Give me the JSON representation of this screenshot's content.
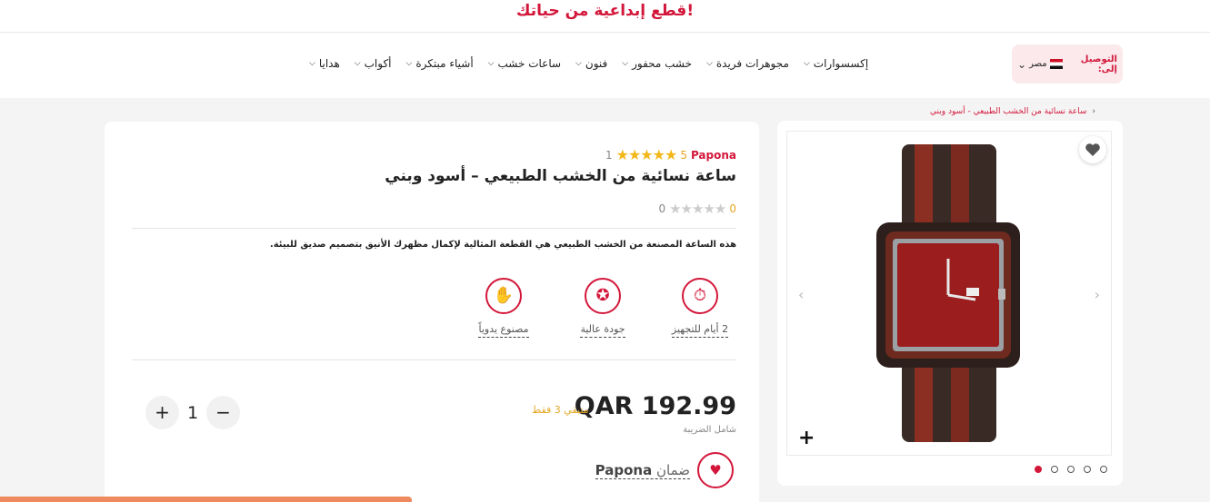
{
  "promo": {
    "text": "قطع إبداعية من حياتك!"
  },
  "shipping": {
    "label": "التوصيل إلى:",
    "country": "مصر"
  },
  "menu": [
    {
      "label": "إكسسوارات"
    },
    {
      "label": "مجوهرات فريدة"
    },
    {
      "label": "خشب محفور"
    },
    {
      "label": "فنون"
    },
    {
      "label": "ساعات خشب"
    },
    {
      "label": "أشياء مبتكرة"
    },
    {
      "label": "أكواب"
    },
    {
      "label": "هدايا"
    }
  ],
  "breadcrumb": "ساعة نسائية من الخشب الطبيعي - أسود وبني",
  "product": {
    "brand": "Papona",
    "rating_value": "5",
    "stars": "★★★★★",
    "rating_count": "1",
    "title": "ساعة نسائية من الخشب الطبيعي – أسود وبني",
    "reviews_rating": "0",
    "reviews_stars": "★★★★★",
    "reviews_count": "0",
    "description": "هذه الساعة المصنعة من الخشب الطبيعي هي القطعة المثالية لإكمال مظهرك الأنيق بتصميم صديق للبيئة.",
    "features": [
      {
        "label": "2 أيام للتجهيز",
        "icon": "timer-icon"
      },
      {
        "label": "جودة عالية",
        "icon": "quality-badge-icon"
      },
      {
        "label": "مصنوع يدوياً",
        "icon": "hand-icon"
      }
    ],
    "price": "QAR 192.99",
    "stock": "متبقي 3 فقط",
    "tax": "شامل الضريبة",
    "quantity": "1",
    "guarantee_label": "ضمان",
    "guarantee_brand": "Papona"
  },
  "gallery": {
    "dots": 5,
    "active_dot": 0,
    "prev": "‹",
    "next": "›",
    "zoom": "+"
  },
  "colors": {
    "accent": "#d3173a",
    "star": "#f2b71a",
    "stock": "#e5a823",
    "progress": "#ef8a60"
  },
  "progress": {
    "fraction": 0.34
  }
}
